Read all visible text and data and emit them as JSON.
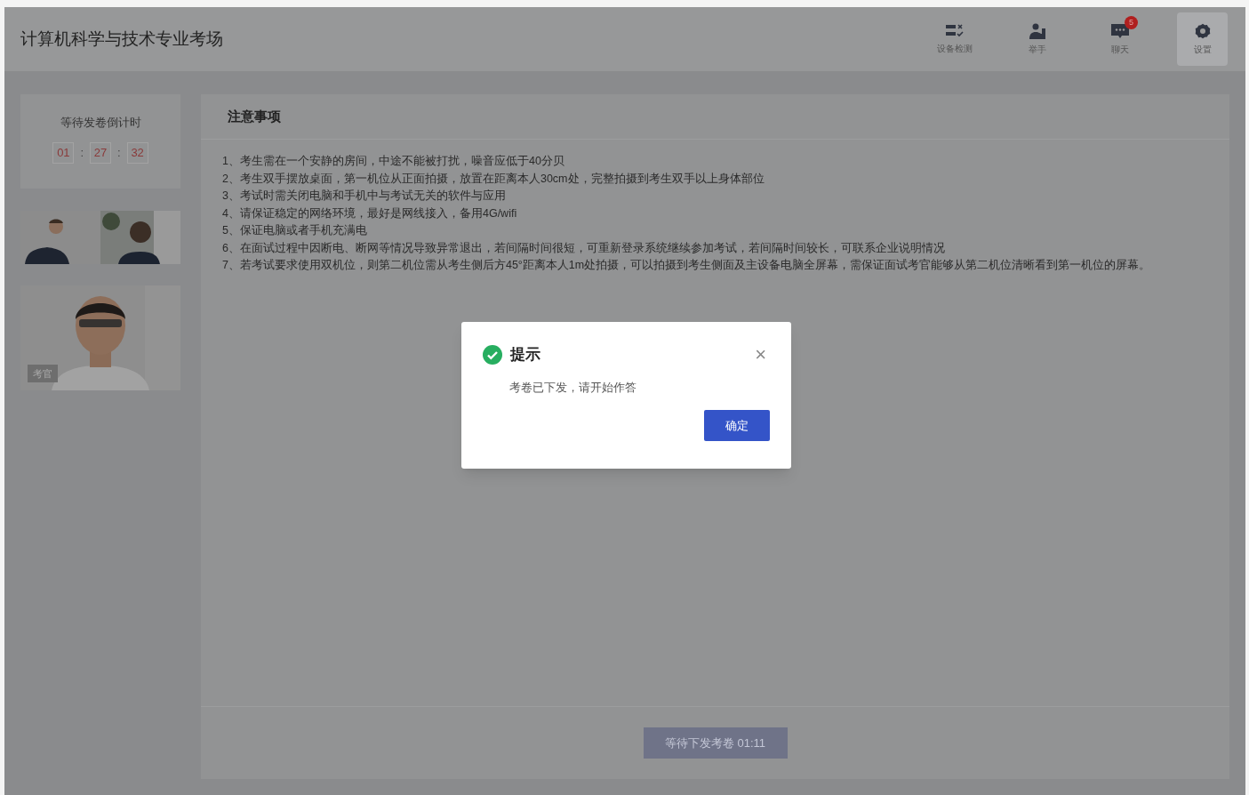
{
  "header": {
    "title": "计算机科学与技术专业考场",
    "tools": [
      {
        "kind": "device",
        "label": "设备检测",
        "selected": false
      },
      {
        "kind": "hand",
        "label": "举手",
        "selected": false
      },
      {
        "kind": "chat",
        "label": "聊天",
        "selected": false,
        "badge": "5"
      },
      {
        "kind": "settings",
        "label": "设置",
        "selected": true
      }
    ]
  },
  "countdown": {
    "title": "等待发卷倒计时",
    "hours": "01",
    "minutes": "27",
    "seconds": "32",
    "separators": [
      ":",
      ":"
    ]
  },
  "videos": [
    {
      "kind": "picture"
    },
    {
      "kind": "picture",
      "label": "考官"
    }
  ],
  "notice": {
    "title": "注意事项",
    "items": [
      "1、考生需在一个安静的房间，中途不能被打扰，噪音应低于40分贝",
      "2、考生双手摆放桌面，第一机位从正面拍摄，放置在距离本人30cm处，完整拍摄到考生双手以上身体部位",
      "3、考试时需关闭电脑和手机中与考试无关的软件与应用",
      "4、请保证稳定的网络环境，最好是网线接入，备用4G/wifi",
      "5、保证电脑或者手机充满电",
      "6、在面试过程中因断电、断网等情况导致异常退出，若间隔时间很短，可重新登录系统继续参加考试，若间隔时间较长，可联系企业说明情况",
      "7、若考试要求使用双机位，则第二机位需从考生侧后方45°距离本人1m处拍摄，可以拍摄到考生侧面及主设备电脑全屏幕，需保证面试考官能够从第二机位清晰看到第一机位的屏幕。"
    ],
    "button": {
      "label": "等待下发考卷 01:11",
      "disabled": true
    }
  },
  "dialog": {
    "title": "提示",
    "message": "考卷已下发，请开始作答",
    "close": "×",
    "confirm": "确定"
  }
}
